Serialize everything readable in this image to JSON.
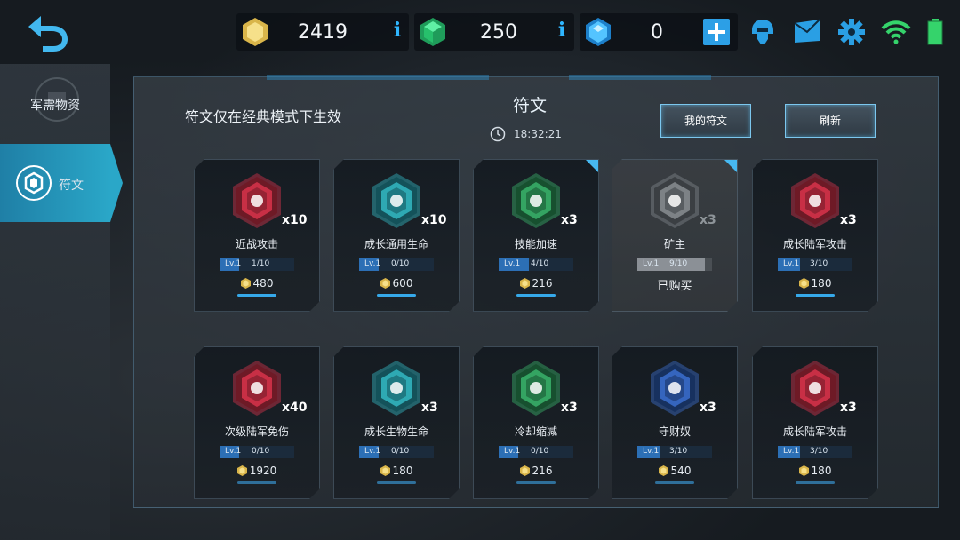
{
  "currency": {
    "gold": "2419",
    "green": "250",
    "blue": "0",
    "info_glyph": "i"
  },
  "icons": {
    "back": "back-arrow-icon",
    "gold": "gold-hex-icon",
    "green": "green-gem-icon",
    "blue": "blue-diamond-icon",
    "add": "plus-icon",
    "helmet": "helmet-icon",
    "mail": "mail-icon",
    "settings": "gear-icon",
    "wifi": "wifi-icon",
    "battery": "battery-icon"
  },
  "colors": {
    "accent": "#2aa7c8",
    "button_border": "#7cc7ee",
    "gold": "#e2c86a",
    "green": "#2fd67e",
    "blue": "#3fb1ff",
    "red_rune": "#d8344b",
    "teal_rune": "#33b9c3",
    "green_rune": "#3ab36b",
    "navy_rune": "#3b6fcf",
    "grey_rune": "#8a8e92"
  },
  "nav": {
    "items": [
      {
        "label": "军需物资"
      },
      {
        "label": "符文"
      }
    ]
  },
  "panel": {
    "title": "符文",
    "notice": "符文仅在经典模式下生效",
    "timer": "18:32:21",
    "my_runes_label": "我的符文",
    "refresh_label": "刷新"
  },
  "runes": [
    {
      "name": "近战攻击",
      "count": "x10",
      "level": "Lv.1",
      "progress": "1/10",
      "progress_fraction": 0.1,
      "price": "480",
      "color": "red",
      "icon": "sword-icon"
    },
    {
      "name": "成长通用生命",
      "count": "x10",
      "level": "Lv.1",
      "progress": "0/10",
      "progress_fraction": 0.0,
      "price": "600",
      "color": "teal",
      "icon": "castle-growth-icon"
    },
    {
      "name": "技能加速",
      "count": "x3",
      "level": "Lv.1",
      "progress": "4/10",
      "progress_fraction": 0.4,
      "price": "216",
      "color": "green",
      "icon": "skill-face-icon",
      "new": true
    },
    {
      "name": "矿主",
      "count": "x3",
      "level": "Lv.1",
      "progress": "9/10",
      "progress_fraction": 0.9,
      "price": "",
      "color": "grey",
      "icon": "miner-icon",
      "new": true,
      "status": "已购买"
    },
    {
      "name": "成长陆军攻击",
      "count": "x3",
      "level": "Lv.1",
      "progress": "3/10",
      "progress_fraction": 0.3,
      "price": "180",
      "color": "red",
      "icon": "army-attack-icon"
    },
    {
      "name": "次级陆军免伤",
      "count": "x40",
      "level": "Lv.1",
      "progress": "0/10",
      "progress_fraction": 0.0,
      "price": "1920",
      "color": "red",
      "icon": "army-shield-icon"
    },
    {
      "name": "成长生物生命",
      "count": "x3",
      "level": "Lv.1",
      "progress": "0/10",
      "progress_fraction": 0.0,
      "price": "180",
      "color": "teal",
      "icon": "creature-growth-icon"
    },
    {
      "name": "冷却缩减",
      "count": "x3",
      "level": "Lv.1",
      "progress": "0/10",
      "progress_fraction": 0.0,
      "price": "216",
      "color": "green",
      "icon": "hourglass-icon"
    },
    {
      "name": "守财奴",
      "count": "x3",
      "level": "Lv.1",
      "progress": "3/10",
      "progress_fraction": 0.3,
      "price": "540",
      "color": "navy",
      "icon": "money-bag-icon"
    },
    {
      "name": "成长陆军攻击",
      "count": "x3",
      "level": "Lv.1",
      "progress": "3/10",
      "progress_fraction": 0.3,
      "price": "180",
      "color": "red",
      "icon": "army-attack-icon"
    }
  ]
}
